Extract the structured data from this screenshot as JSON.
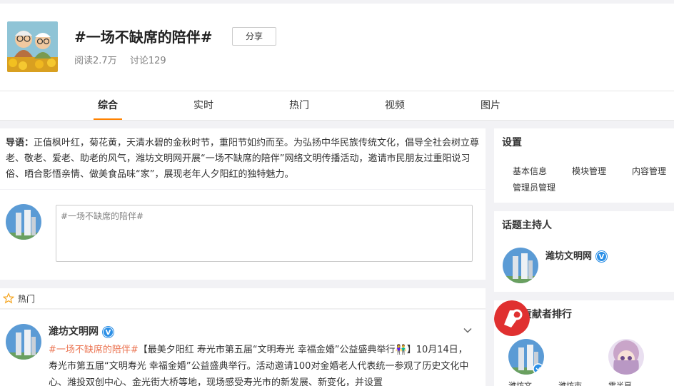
{
  "topic": {
    "title": "#一场不缺席的陪伴#",
    "share_label": "分享",
    "reads": "阅读2.7万",
    "discussions": "讨论129"
  },
  "tabs": [
    {
      "label": "综合",
      "active": true
    },
    {
      "label": "实时",
      "active": false
    },
    {
      "label": "热门",
      "active": false
    },
    {
      "label": "视频",
      "active": false
    },
    {
      "label": "图片",
      "active": false
    }
  ],
  "lead": {
    "prefix": "导语：",
    "text": "正值枫叶红，菊花黄，天清水碧的金秋时节，重阳节如约而至。为弘扬中华民族传统文化，倡导全社会树立尊老、敬老、爱老、助老的风气，潍坊文明网开展“一场不缺席的陪伴”网络文明传播活动，邀请市民朋友过重阳说习俗、晒合影悟亲情、做美食品味“家”，展现老年人夕阳红的独特魅力。"
  },
  "composer": {
    "placeholder": "#一场不缺席的陪伴#"
  },
  "hot_section": {
    "label": "热门"
  },
  "post": {
    "author": "潍坊文明网",
    "verified_icon": "v-badge-icon",
    "tag": "#一场不缺席的陪伴#",
    "text": "【最美夕阳红 寿光市第五届“文明寿光 幸福金婚”公益盛典举行👫】10月14日，寿光市第五届“文明寿光 幸福金婚”公益盛典举行。活动邀请100对金婚老人代表统一参观了历史文化中心、潍投双创中心、金光街大桥等地，现场感受寿光市的新发展、新变化，并设置"
  },
  "sidebar": {
    "settings": {
      "title": "设置",
      "links": [
        "基本信息",
        "模块管理",
        "内容管理",
        "管理员管理"
      ]
    },
    "host": {
      "title": "话题主持人",
      "name": "潍坊文明网"
    },
    "ranking": {
      "title": "话题贡献者排行",
      "contributors": [
        "潍坊文...",
        "潍坊市...",
        "雪半夏"
      ]
    }
  },
  "colors": {
    "accent": "#ff8200",
    "tag": "#eb7350",
    "verified": "#2b8fe6"
  }
}
